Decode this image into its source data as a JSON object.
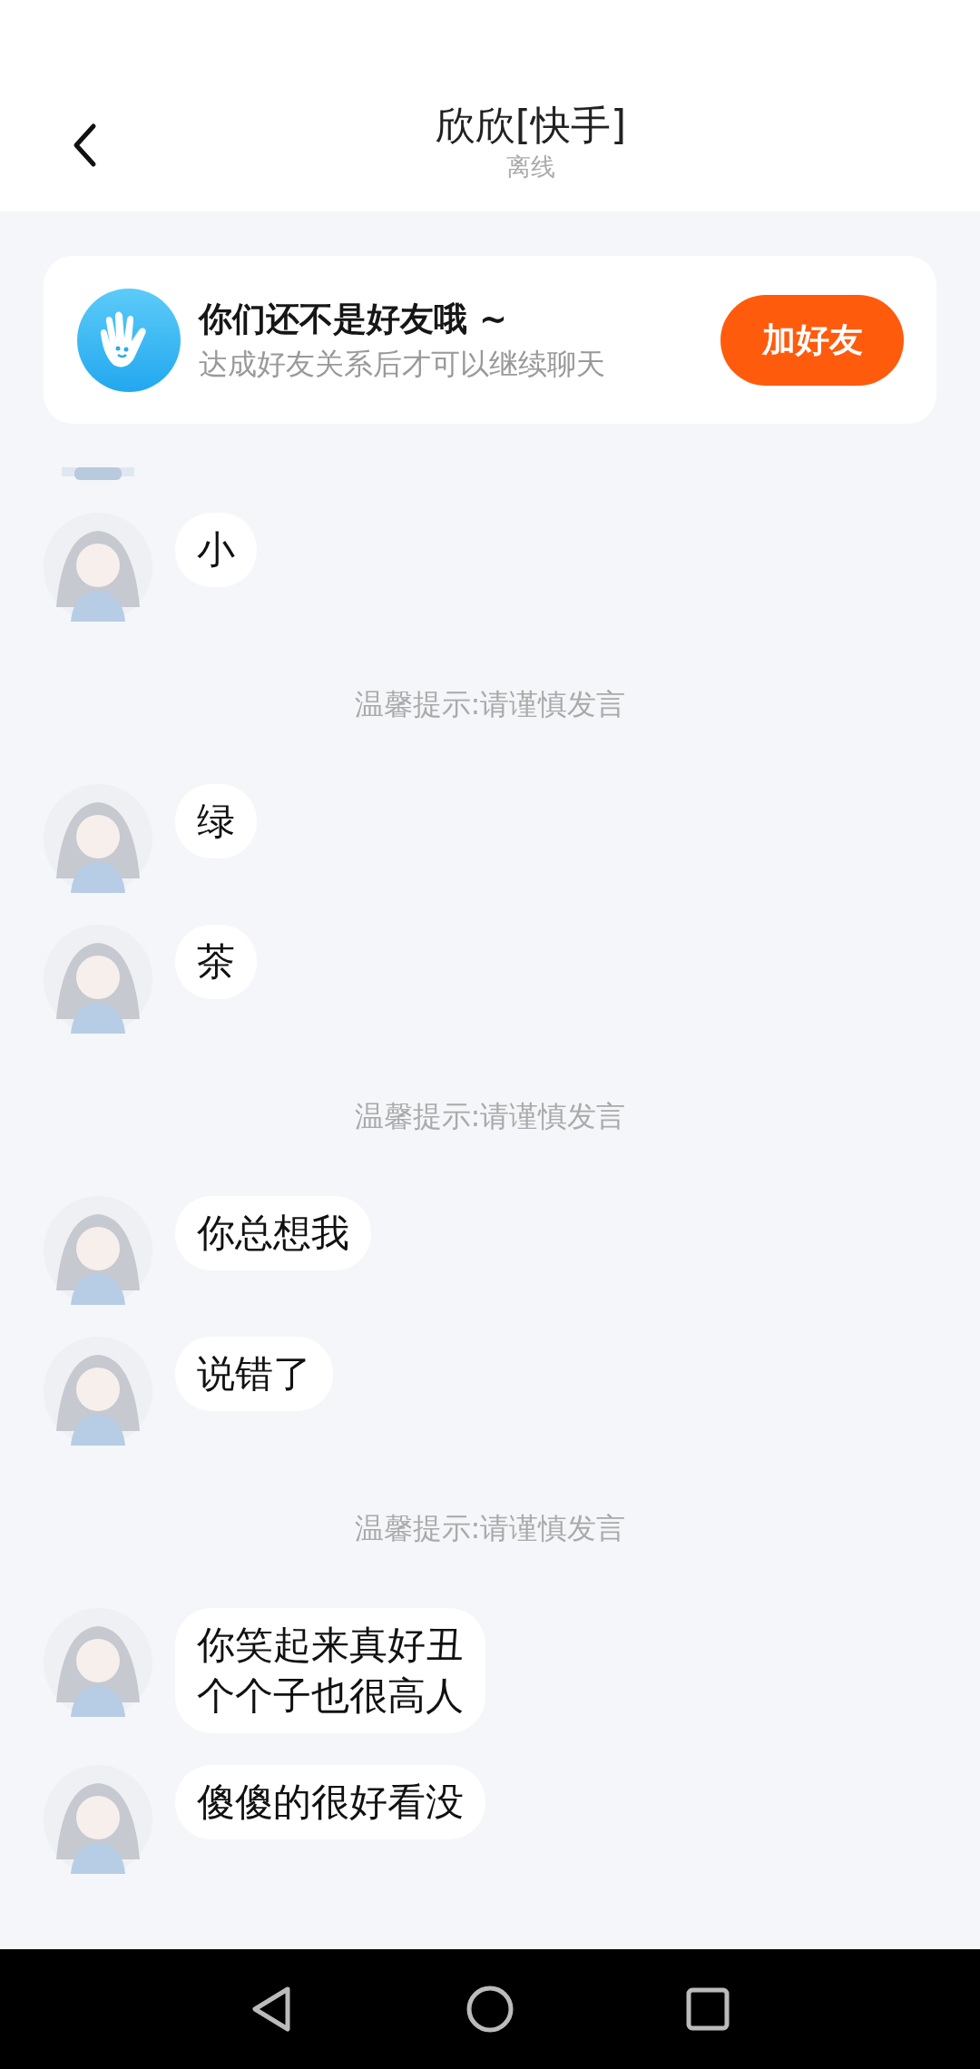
{
  "header": {
    "title": "欣欣[快手]",
    "status": "离线"
  },
  "banner": {
    "title": "你们还不是好友哦 ~",
    "subtitle": "达成好友关系后才可以继续聊天",
    "button": "加好友"
  },
  "messages": [
    {
      "kind": "cut_off"
    },
    {
      "kind": "message",
      "lines": [
        "小"
      ]
    },
    {
      "kind": "tip",
      "text": "温馨提示:请谨慎发言"
    },
    {
      "kind": "message",
      "lines": [
        "绿"
      ]
    },
    {
      "kind": "message",
      "lines": [
        "茶"
      ]
    },
    {
      "kind": "tip",
      "text": "温馨提示:请谨慎发言"
    },
    {
      "kind": "message",
      "lines": [
        "你总想我"
      ]
    },
    {
      "kind": "message",
      "lines": [
        "说错了"
      ]
    },
    {
      "kind": "tip",
      "text": "温馨提示:请谨慎发言"
    },
    {
      "kind": "message",
      "lines": [
        "你笑起来真好丑",
        "个个子也很高人"
      ]
    },
    {
      "kind": "message",
      "lines": [
        "傻傻的很好看没"
      ]
    }
  ]
}
